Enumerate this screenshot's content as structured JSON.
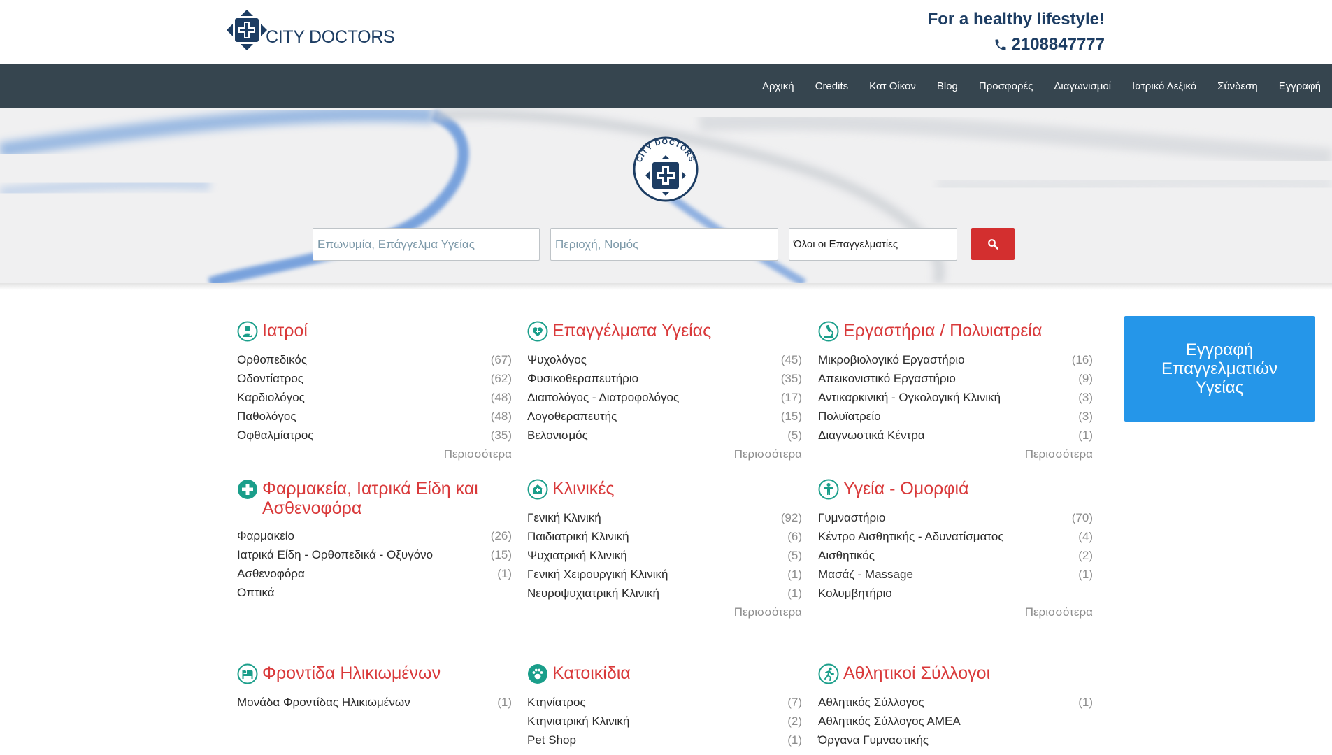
{
  "header": {
    "logo_text": "CITY DOCTORS",
    "tagline": "For a healthy lifestyle!",
    "phone": "2108847777"
  },
  "nav": {
    "items": [
      "Αρχική",
      "Credits",
      "Κατ Οίκον",
      "Blog",
      "Προσφορές",
      "Διαγωνισμοί",
      "Ιατρικό Λεξικό",
      "Σύνδεση",
      "Εγγραφή"
    ]
  },
  "hero": {
    "emblem_text": "CITY DOCTORS",
    "search_name_placeholder": "Επωνυμία, Επάγγελμα Υγείας",
    "search_area_placeholder": "Περιοχή, Νομός",
    "search_type_value": "Όλοι οι Επαγγελματίες"
  },
  "cta": {
    "label": "Εγγραφή Επαγγελματιών Υγείας"
  },
  "colors": {
    "accent_red": "#d9393a",
    "icon_teal": "#1a9e8a",
    "navy": "#1d3d63",
    "nav_bg": "#36454f",
    "cta_blue": "#2596e9",
    "search_red": "#d32f2f"
  },
  "categories": [
    {
      "title": "Ιατροί",
      "icon": "doctor-icon",
      "more": "Περισσότερα",
      "items": [
        {
          "label": "Ορθοπεδικός",
          "count": "(67)"
        },
        {
          "label": "Οδοντίατρος",
          "count": "(62)"
        },
        {
          "label": "Καρδιολόγος",
          "count": "(48)"
        },
        {
          "label": "Παθολόγος",
          "count": "(48)"
        },
        {
          "label": "Οφθαλμίατρος",
          "count": "(35)"
        }
      ]
    },
    {
      "title": "Επαγγέλματα Υγείας",
      "icon": "heart-care-icon",
      "more": "Περισσότερα",
      "items": [
        {
          "label": "Ψυχολόγος",
          "count": "(45)"
        },
        {
          "label": "Φυσικοθεραπευτήριο",
          "count": "(35)"
        },
        {
          "label": "Διαιτολόγος - Διατροφολόγος",
          "count": "(17)"
        },
        {
          "label": "Λογοθεραπευτής",
          "count": "(15)"
        },
        {
          "label": "Βελονισμός",
          "count": "(5)"
        }
      ]
    },
    {
      "title": "Εργαστήρια / Πολυιατρεία",
      "icon": "microscope-icon",
      "more": "Περισσότερα",
      "items": [
        {
          "label": "Μικροβιολογικό Εργαστήριο",
          "count": "(16)"
        },
        {
          "label": "Απεικονιστικό Εργαστήριο",
          "count": "(9)"
        },
        {
          "label": "Αντικαρκινική - Ογκολογική Κλινική",
          "count": "(3)"
        },
        {
          "label": "Πολυϊατρείο",
          "count": "(3)"
        },
        {
          "label": "Διαγνωστικά Κέντρα",
          "count": "(1)"
        }
      ]
    },
    {
      "title": "Φαρμακεία, Ιατρικά Είδη και Ασθενοφόρα",
      "icon": "pharmacy-cross-icon",
      "more": "",
      "items": [
        {
          "label": "Φαρμακείο",
          "count": "(26)"
        },
        {
          "label": "Ιατρικά Είδη - Ορθοπεδικά - Οξυγόνο",
          "count": "(15)"
        },
        {
          "label": "Ασθενοφόρα",
          "count": "(1)"
        },
        {
          "label": "Οπτικά",
          "count": ""
        }
      ]
    },
    {
      "title": "Κλινικές",
      "icon": "clinic-house-icon",
      "more": "Περισσότερα",
      "items": [
        {
          "label": "Γενική Κλινική",
          "count": "(92)"
        },
        {
          "label": "Παιδιατρική Κλινική",
          "count": "(6)"
        },
        {
          "label": "Ψυχιατρική Κλινική",
          "count": "(5)"
        },
        {
          "label": "Γενική Χειρουργική Κλινική",
          "count": "(1)"
        },
        {
          "label": "Νευροψυχιατρική Κλινική",
          "count": "(1)"
        }
      ]
    },
    {
      "title": "Υγεία - Ομορφιά",
      "icon": "person-wellness-icon",
      "more": "Περισσότερα",
      "items": [
        {
          "label": "Γυμναστήριο",
          "count": "(70)"
        },
        {
          "label": "Κέντρο Αισθητικής - Αδυνατίσματος",
          "count": "(4)"
        },
        {
          "label": "Αισθητικός",
          "count": "(2)"
        },
        {
          "label": "Μασάζ - Massage",
          "count": "(1)"
        },
        {
          "label": "Κολυμβητήριο",
          "count": ""
        }
      ]
    },
    {
      "title": "Φροντίδα Ηλικιωμένων",
      "icon": "elderly-bed-icon",
      "more": "",
      "items": [
        {
          "label": "Μονάδα Φροντίδας Ηλικιωμένων",
          "count": "(1)"
        }
      ]
    },
    {
      "title": "Κατοικίδια",
      "icon": "paw-icon",
      "more": "",
      "items": [
        {
          "label": "Κτηνίατρος",
          "count": "(7)"
        },
        {
          "label": "Κτηνιατρική Κλινική",
          "count": "(2)"
        },
        {
          "label": "Pet Shop",
          "count": "(1)"
        }
      ]
    },
    {
      "title": "Αθλητικοί Σύλλογοι",
      "icon": "runner-icon",
      "more": "",
      "items": [
        {
          "label": "Αθλητικός Σύλλογος",
          "count": "(1)"
        },
        {
          "label": "Αθλητικός Σύλλογος ΑΜΕΑ",
          "count": ""
        },
        {
          "label": "Όργανα Γυμναστικής",
          "count": ""
        }
      ]
    }
  ]
}
